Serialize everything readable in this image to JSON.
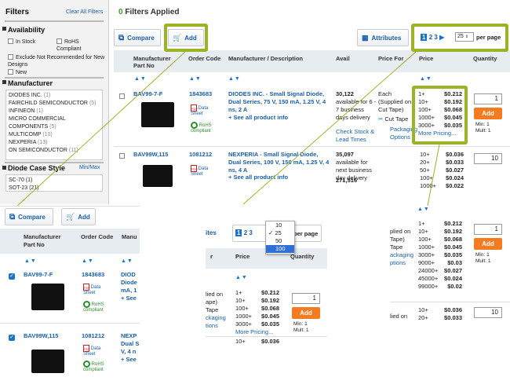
{
  "filters": {
    "title": "Filters",
    "clear_all": "Clear All Filters",
    "availability": {
      "title": "Availability",
      "items": [
        "In Stock",
        "RoHS Compliant",
        "Exclude Not Recommended for New Designs",
        "New"
      ]
    },
    "manufacturer": {
      "title": "Manufacturer",
      "items": [
        {
          "name": "DIODES INC.",
          "count": "(1)"
        },
        {
          "name": "FAIRCHILD SEMICONDUCTOR",
          "count": "(5)"
        },
        {
          "name": "INFINEON",
          "count": "(1)"
        },
        {
          "name": "MICRO COMMERCIAL COMPONENTS",
          "count": "(5)"
        },
        {
          "name": "MULTICOMP",
          "count": "(10)"
        },
        {
          "name": "NEXPERIA",
          "count": "(13)"
        },
        {
          "name": "ON SEMICONDUCTOR",
          "count": "(11)"
        }
      ]
    },
    "diode_case": {
      "title": "Diode Case Style",
      "minmax": "Min/Max",
      "items": [
        "SC-70 (1)",
        "SOT-23 (21)"
      ]
    }
  },
  "main": {
    "filters_applied_count": "0",
    "filters_applied_label": "Filters Applied",
    "compare": "Compare",
    "add": "Add",
    "attributes": "Attributes",
    "pagination": {
      "pages": [
        "1",
        "2",
        "3"
      ],
      "per_page_value": "25",
      "per_page_label": "per page"
    },
    "headers": {
      "mfr_part": "Manufacturer Part No",
      "order_code": "Order Code",
      "mfr_desc": "Manufacturer / Description",
      "avail": "Avail",
      "price_for": "Price For",
      "price": "Price",
      "quantity": "Quantity"
    },
    "rows": [
      {
        "part": "BAV99-7-F",
        "order": "1843683",
        "datasheet": "Data Sheet",
        "rohs": "RoHS compliant",
        "desc": "DIODES INC. - Small Signal Diode, Dual Series, 75 V, 150 mA, 1.25 V, 4 ns, 2 A",
        "see_all": "+ See all product info",
        "avail_qty": "30,122",
        "avail_text": "available for 6 - 7 business days delivery",
        "check_stock": "Check Stock & Lead Times",
        "price_for": "Each (Supplied on Cut Tape)",
        "cut_tape": "Cut Tape",
        "packaging": "Packaging Options",
        "prices": [
          [
            "1+",
            "$0.212"
          ],
          [
            "10+",
            "$0.192"
          ],
          [
            "100+",
            "$0.068"
          ],
          [
            "1000+",
            "$0.045"
          ],
          [
            "3000+",
            "$0.035"
          ]
        ],
        "more_pricing": "More Pricing...",
        "qty": "1",
        "add": "Add",
        "min": "Min: 1",
        "mult": "Mult: 1"
      },
      {
        "part": "BAV99W,115",
        "order": "1081212",
        "datasheet": "Data Sheet",
        "rohs": "RoHS compliant",
        "desc": "NEXPERIA - Small Signal Diode, Dual Series, 100 V, 150 mA, 1.25 V, 4 ns, 4 A",
        "see_all": "+ See all product info",
        "avail_qty": "35,097",
        "avail_text": "available for next business day delivery",
        "avail_qty2": "271,516",
        "prices": [
          [
            "10+",
            "$0.036"
          ],
          [
            "20+",
            "$0.033"
          ],
          [
            "50+",
            "$0.027"
          ],
          [
            "100+",
            "$0.024"
          ],
          [
            "1000+",
            "$0.022"
          ]
        ],
        "qty": "10"
      }
    ]
  },
  "zoom_compare": {
    "compare": "Compare",
    "add": "Add",
    "mfr_part": "Manufacturer Part No",
    "order_code": "Order Code",
    "manu_cut": "Manu",
    "rows": [
      {
        "part": "BAV99-7-F",
        "order": "1843683",
        "datasheet": "Data Sheet",
        "rohs": "RoHS compliant",
        "desc_frag": [
          "DIOD",
          "Diode",
          "mA, 1",
          "+ See"
        ]
      },
      {
        "part": "BAV99W,115",
        "order": "1081212",
        "datasheet": "Data Sheet",
        "rohs": "RoHS compliant",
        "desc_frag": [
          "NEXP",
          "Dual S",
          "V, 4 n",
          "+ See"
        ]
      }
    ]
  },
  "zoom_pagination": {
    "attributes_cut": "ites",
    "pages": [
      "1",
      "2",
      "3"
    ],
    "options": [
      "10",
      "25",
      "50",
      "100"
    ],
    "selected": "25",
    "highlighted": "100",
    "per_page_label": "per page",
    "price_for_hdr": "r",
    "price_hdr": "Price",
    "qty_hdr": "Quantity",
    "left_frags": [
      "lied on",
      "ape)",
      "Tape",
      "ckaging",
      "tions"
    ],
    "prices": [
      [
        "1+",
        "$0.212"
      ],
      [
        "10+",
        "$0.192"
      ],
      [
        "100+",
        "$0.068"
      ],
      [
        "1000+",
        "$0.045"
      ],
      [
        "3000+",
        "$0.035"
      ]
    ],
    "more_pricing": "More Pricing...",
    "qty": "1",
    "add": "Add",
    "min": "Min: 1",
    "mult": "Mult: 1",
    "next_prices": [
      [
        "10+",
        "$0.036"
      ],
      [
        "20+",
        "$0.033"
      ]
    ],
    "next_frag": "lied on",
    "next_qty": "10"
  },
  "zoom_more_pricing": {
    "left_frags": [
      "plied on",
      "Tape)",
      "Tape",
      "ackaging",
      "ptions"
    ],
    "prices": [
      [
        "1+",
        "$0.212"
      ],
      [
        "10+",
        "$0.192"
      ],
      [
        "100+",
        "$0.068"
      ],
      [
        "1000+",
        "$0.045"
      ],
      [
        "3000+",
        "$0.035"
      ],
      [
        "9000+",
        "$0.03"
      ],
      [
        "24000+",
        "$0.027"
      ],
      [
        "45000+",
        "$0.024"
      ],
      [
        "99000+",
        "$0.02"
      ]
    ],
    "qty": "1",
    "add": "Add",
    "min": "Min: 1",
    "mult": "Mult: 1",
    "next_prices": [
      [
        "10+",
        "$0.036"
      ],
      [
        "20+",
        "$0.033"
      ]
    ],
    "next_frag": "lied on",
    "next_qty": "10"
  },
  "colors": {
    "highlight": "#9cb325",
    "add_button": "#f47b20",
    "link": "#1a5fa8"
  }
}
